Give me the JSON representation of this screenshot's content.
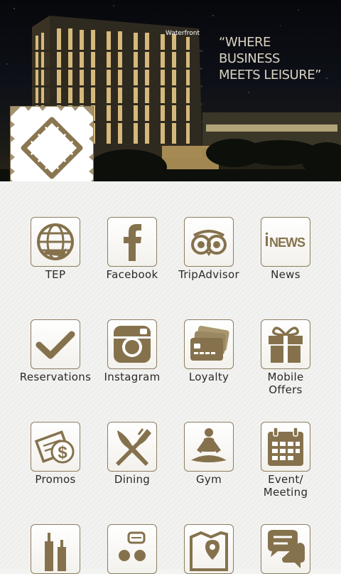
{
  "banner": {
    "tagline_line1": "“WHERE BUSINESS",
    "tagline_line2": "MEETS LEISURE”",
    "sign_text": "Waterfront"
  },
  "accent_color": "#85724d",
  "grid": [
    {
      "label": "TEP",
      "icon": "globe-icon"
    },
    {
      "label": "Facebook",
      "icon": "facebook-icon"
    },
    {
      "label": "TripAdvisor",
      "icon": "tripadvisor-owl-icon"
    },
    {
      "label": "News",
      "icon": "news-icon",
      "icon_text": "NEWS"
    },
    {
      "label": "Reservations",
      "icon": "checkmark-icon"
    },
    {
      "label": "Instagram",
      "icon": "instagram-camera-icon"
    },
    {
      "label": "Loyalty",
      "icon": "credit-cards-icon"
    },
    {
      "label": "Mobile Offers",
      "label_line1": "Mobile",
      "label_line2": "Offers",
      "icon": "gift-box-icon"
    },
    {
      "label": "Promos",
      "icon": "coupon-dollar-icon"
    },
    {
      "label": "Dining",
      "icon": "fork-knife-icon"
    },
    {
      "label": "Gym",
      "icon": "yoga-pose-icon"
    },
    {
      "label": "Event/ Meeting",
      "label_line1": "Event/",
      "label_line2": "Meeting",
      "icon": "calendar-icon"
    },
    {
      "label": "",
      "icon": "city-towers-icon"
    },
    {
      "label": "",
      "icon": "people-chat-icon"
    },
    {
      "label": "",
      "icon": "map-pin-icon"
    },
    {
      "label": "",
      "icon": "speech-bubbles-icon"
    }
  ]
}
